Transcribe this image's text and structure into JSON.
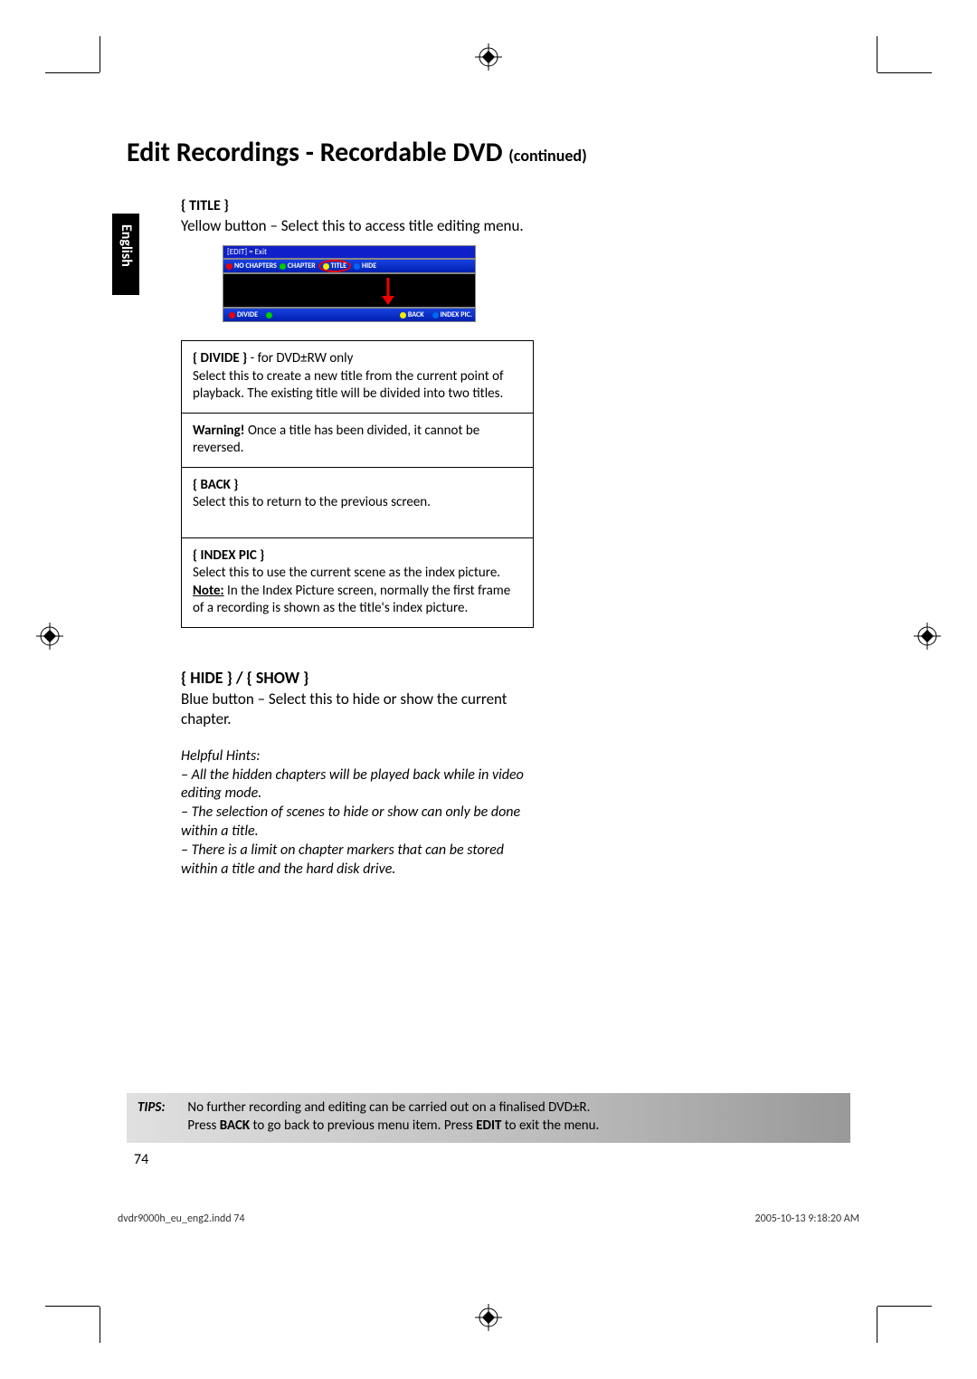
{
  "heading_main": "Edit Recordings - Recordable DVD ",
  "heading_sub": "(continued)",
  "language_tab": "English",
  "title_section": {
    "label": "{ TITLE }",
    "desc": "Yellow button – Select this to access title editing menu."
  },
  "osd": {
    "top": "[EDIT] = Exit",
    "row1": [
      "NO CHAPTERS",
      "CHAPTER",
      "TITLE",
      "HIDE"
    ],
    "row2_left": "DIVIDE",
    "row2_right": [
      "BACK",
      "INDEX PIC."
    ]
  },
  "divide": {
    "label": "{ DIVIDE }",
    "suffix": " - for DVD±RW only",
    "desc": "Select this to create a new title from the current point of playback. The existing title will be divided into two titles.",
    "warn_label": "Warning!",
    "warn_text": " Once a title has been divided, it cannot be reversed."
  },
  "back": {
    "label": "{ BACK }",
    "desc": "Select this to return to the previous screen."
  },
  "indexpic": {
    "label": "{ INDEX PIC }",
    "desc": "Select this to use the current scene as the index picture.",
    "note_label": "Note:",
    "note_text": " In the Index Picture screen, normally the first frame of a recording is shown as the title's index picture."
  },
  "hide": {
    "label": "{ HIDE } / { SHOW }",
    "desc": "Blue button – Select this to hide or show the current chapter."
  },
  "hints": {
    "title": "Helpful Hints:",
    "h1": "– All the hidden chapters will be played back while in video editing mode.",
    "h2": "– The selection of scenes to hide or show can only be done within a title.",
    "h3": "– There is a limit on chapter markers that can be stored within a title and the hard disk drive."
  },
  "tips": {
    "label": "TIPS:",
    "line1a": "No further recording and editing can be carried out on a finalised DVD±R.",
    "line2a": "Press ",
    "line2b": "BACK",
    "line2c": " to go back to previous menu item. Press ",
    "line2d": "EDIT",
    "line2e": " to exit the menu."
  },
  "page_number": "74",
  "footer_left": "dvdr9000h_eu_eng2.indd   74",
  "footer_right": "2005-10-13   9:18:20 AM"
}
